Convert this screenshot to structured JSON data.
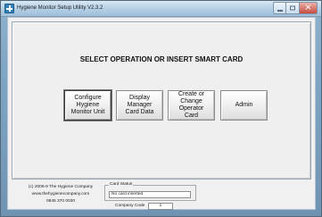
{
  "window": {
    "title": "Hygiene Monitor Setup Utility  V2.3.2",
    "controls": {
      "minimize_icon": "minimize-icon",
      "maximize_icon": "maximize-icon",
      "close_icon": "close-icon",
      "close_glyph": "×"
    }
  },
  "main": {
    "heading": "SELECT OPERATION OR INSERT SMART CARD",
    "buttons": [
      {
        "label": "Configure\nHygiene\nMonitor Unit",
        "state": "selected"
      },
      {
        "label": "Display\nManager\nCard Data",
        "state": "normal"
      },
      {
        "label": "Create or\nChange\nOperator\nCard",
        "state": "normal"
      },
      {
        "label": "Admin",
        "state": "normal"
      }
    ]
  },
  "footer": {
    "copyright": "(c) 2008-9 The Hygiene Company",
    "website": "www.thehygienecompany.com",
    "phone": "0845 370 0030",
    "card_status": {
      "label": "Card Status",
      "value": "No card inserted"
    },
    "company_code": {
      "label": "Company Code",
      "value": "1"
    }
  },
  "colors": {
    "window_frame": "#7fa5c4",
    "client_background": "#f0f0f0",
    "close_button": "#c64b3f",
    "text": "#111111"
  }
}
